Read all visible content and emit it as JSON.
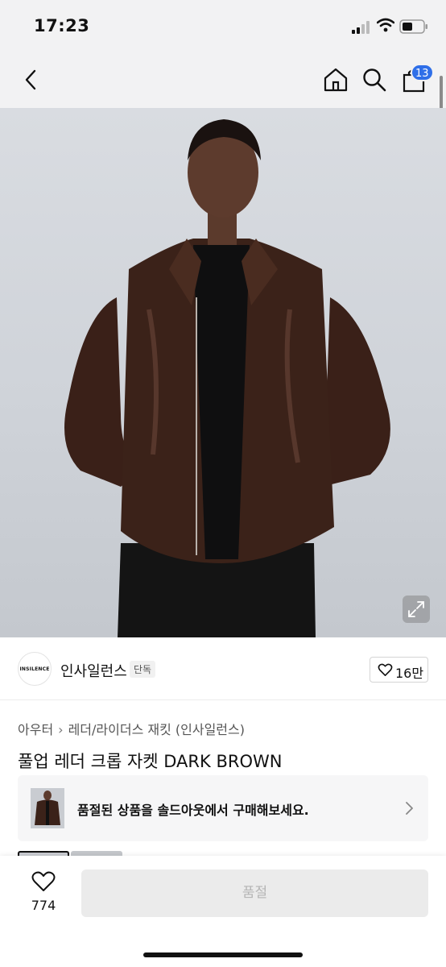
{
  "status_bar": {
    "time": "17:23"
  },
  "nav": {
    "cart_badge": "13"
  },
  "brand": {
    "logo_text": "INSILENCE",
    "name": "인사일런스",
    "tag": "단독",
    "like_count": "16만"
  },
  "breadcrumb": {
    "category": "아우터",
    "subcategory": "레더/라이더스 재킷 (인사일런스)"
  },
  "product": {
    "title": "풀업 레더 크롭 자켓 DARK BROWN"
  },
  "soldout_banner": {
    "text": "품절된 상품을 솔드아웃에서 구매해보세요."
  },
  "bottom_bar": {
    "wish_count": "774",
    "buy_label": "품절"
  },
  "colors": {
    "accent": "#2f6fe8",
    "jacket": "#3a2018",
    "background": "#d3d6db"
  }
}
